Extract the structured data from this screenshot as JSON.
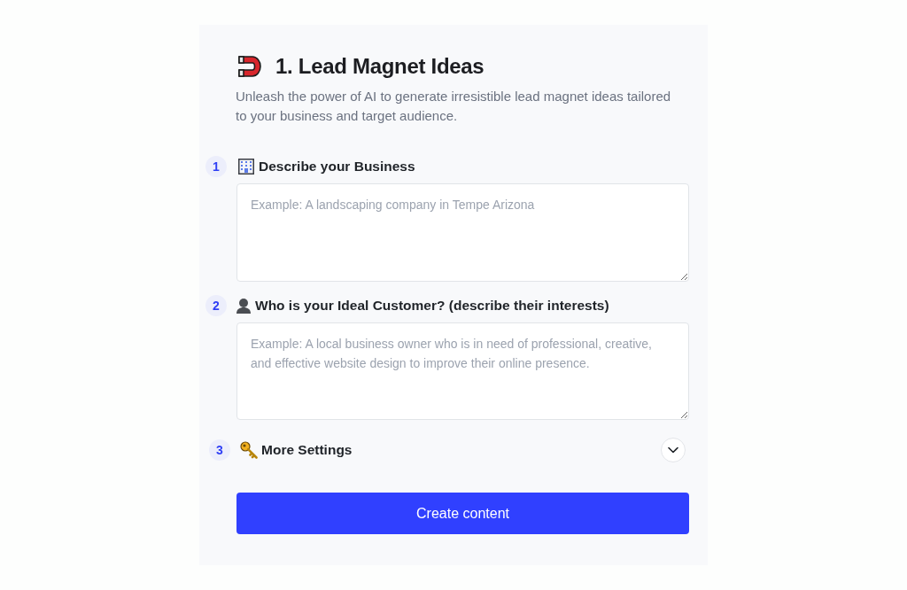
{
  "header": {
    "title": "1. Lead Magnet Ideas",
    "description": "Unleash the power of AI to generate irresistible lead magnet ideas tailored to your business and target audience."
  },
  "steps": [
    {
      "number": "1",
      "kind": "textarea",
      "label": "Describe your Business",
      "placeholder": "Example: A landscaping company in Tempe Arizona"
    },
    {
      "number": "2",
      "kind": "textarea",
      "label": "Who is your Ideal Customer? (describe their interests)",
      "placeholder": "Example: A local business owner who is in need of professional, creative, and effective website design to improve their online presence."
    },
    {
      "number": "3",
      "kind": "collapsible",
      "label": "More Settings",
      "expanded": false
    }
  ],
  "submit_button": {
    "label": "Create content"
  }
}
